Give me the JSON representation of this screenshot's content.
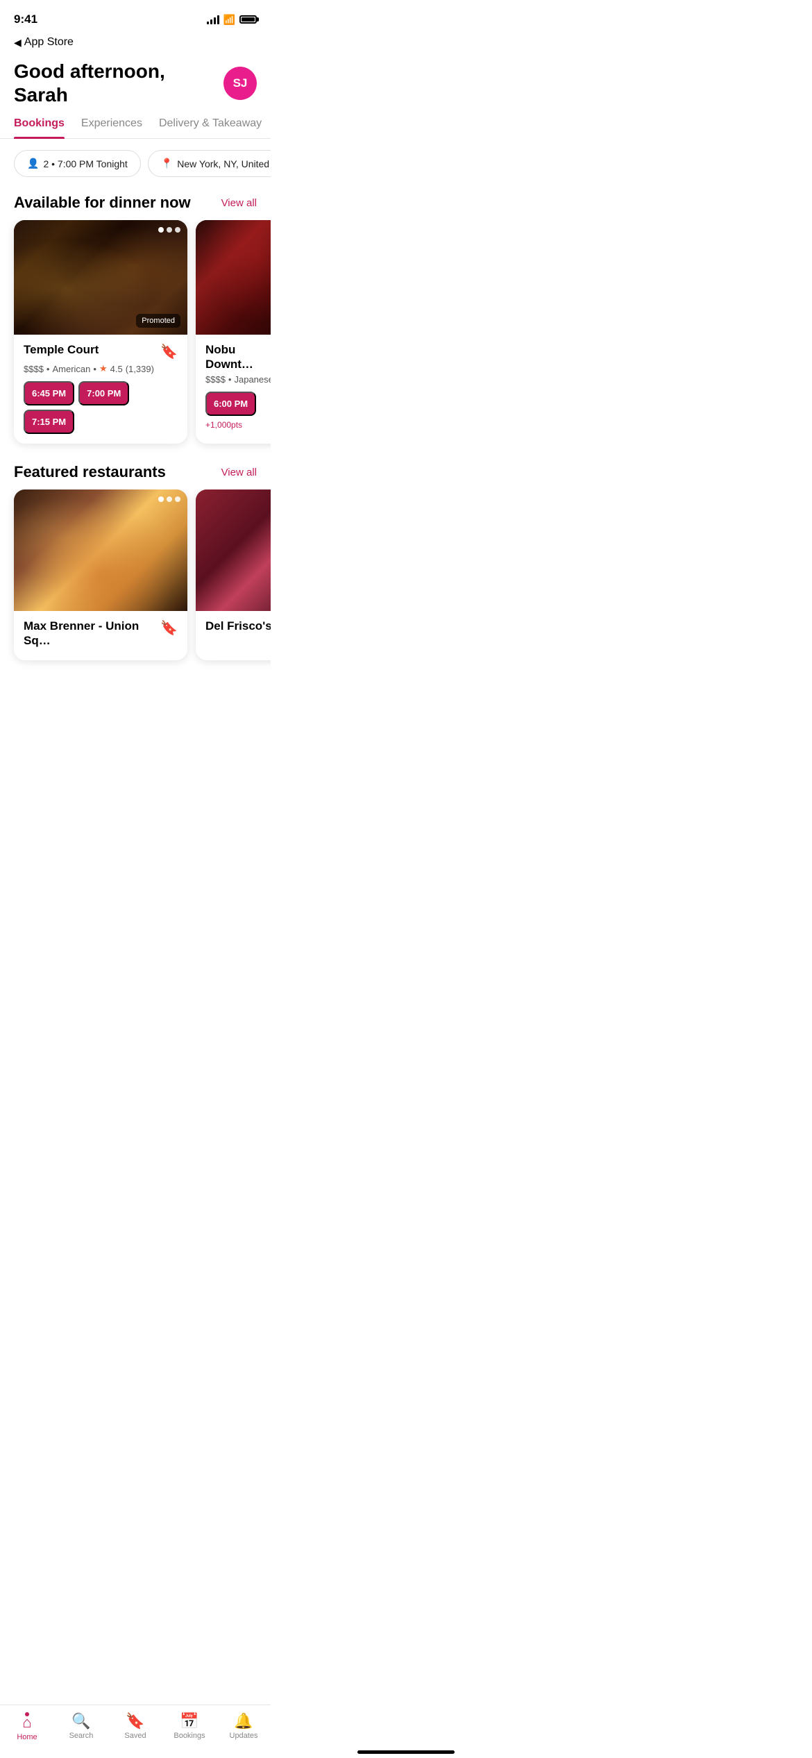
{
  "statusBar": {
    "time": "9:41",
    "backLabel": "App Store"
  },
  "header": {
    "greeting": "Good afternoon, Sarah",
    "avatarInitials": "SJ",
    "avatarBg": "#e91e8c"
  },
  "tabs": [
    {
      "id": "bookings",
      "label": "Bookings",
      "active": true
    },
    {
      "id": "experiences",
      "label": "Experiences",
      "active": false
    },
    {
      "id": "delivery",
      "label": "Delivery & Takeaway",
      "active": false
    }
  ],
  "filters": [
    {
      "id": "guests",
      "icon": "👤",
      "label": "2 • 7:00 PM Tonight"
    },
    {
      "id": "location",
      "icon": "📍",
      "label": "New York, NY, United States"
    }
  ],
  "dinnerSection": {
    "title": "Available for dinner now",
    "viewAll": "View all"
  },
  "dinnerRestaurants": [
    {
      "id": "temple-court",
      "name": "Temple Court",
      "price": "$$$$",
      "cuisine": "American",
      "rating": "4.5",
      "reviewCount": "1,339",
      "promoted": true,
      "timeSlots": [
        "6:45 PM",
        "7:00 PM",
        "7:15 PM"
      ],
      "imageClass": "img-temple-court"
    },
    {
      "id": "nobu-downtown",
      "name": "Nobu Downt…",
      "price": "$$$$",
      "cuisine": "Japanese",
      "rating": null,
      "reviewCount": null,
      "promoted": false,
      "timeSlots": [
        "6:00 PM"
      ],
      "points": "+1,000pts",
      "imageClass": "img-nobu"
    }
  ],
  "featuredSection": {
    "title": "Featured restaurants",
    "viewAll": "View all"
  },
  "featuredRestaurants": [
    {
      "id": "max-brenner",
      "name": "Max Brenner - Union Sq…",
      "imageClass": "img-max-brenner"
    },
    {
      "id": "del-frisco",
      "name": "Del Frisco's G…",
      "imageClass": "img-del-frisco"
    }
  ],
  "tabBar": {
    "items": [
      {
        "id": "home",
        "label": "Home",
        "active": true
      },
      {
        "id": "search",
        "label": "Search",
        "active": false
      },
      {
        "id": "saved",
        "label": "Saved",
        "active": false
      },
      {
        "id": "bookings",
        "label": "Bookings",
        "active": false
      },
      {
        "id": "updates",
        "label": "Updates",
        "active": false
      }
    ]
  }
}
